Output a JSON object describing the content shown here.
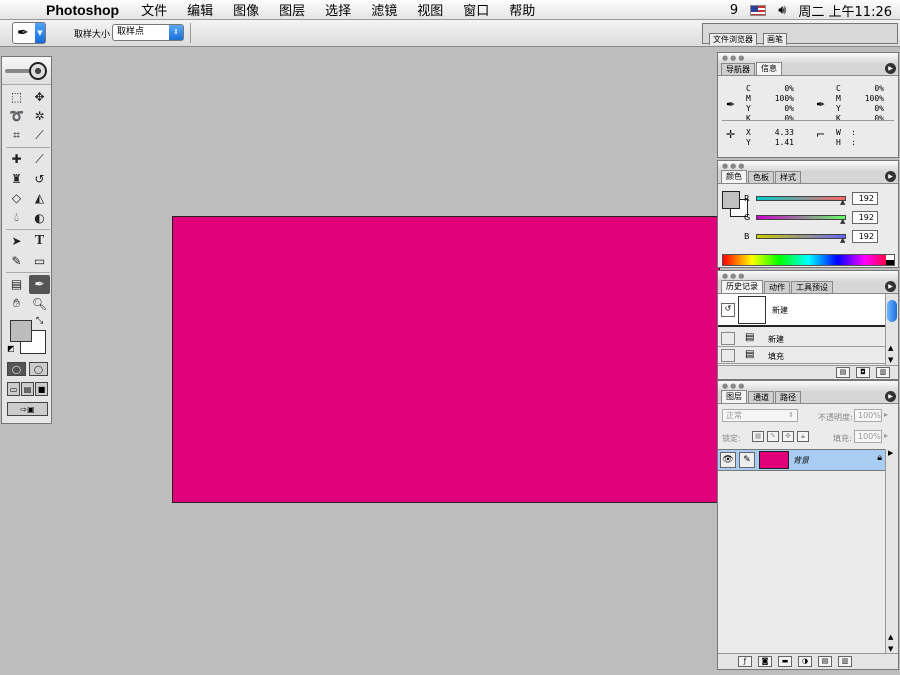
{
  "menubar": {
    "app": "Photoshop",
    "items": [
      "文件",
      "编辑",
      "图像",
      "图层",
      "选择",
      "滤镜",
      "视图",
      "窗口",
      "帮助"
    ],
    "clock": "周二 上午11:26",
    "status_glyph": "9"
  },
  "options": {
    "sample_label": "取样大小",
    "sample_value": "取样点"
  },
  "palette_well": {
    "tabs": [
      "文件浏览器",
      "画笔"
    ]
  },
  "canvas": {
    "fill_color": "#E0007A"
  },
  "info_panel": {
    "tabs": [
      "导航器",
      "信息"
    ],
    "cmyk_labels": [
      "C",
      "M",
      "Y",
      "K"
    ],
    "cmyk_left": [
      "0%",
      "100%",
      "0%",
      "0%"
    ],
    "cmyk_right": [
      "0%",
      "100%",
      "0%",
      "0%"
    ],
    "x_label": "X",
    "x_value": "4.33",
    "y_label": "Y",
    "y_value": "1.41",
    "w_label": "W",
    "h_label": "H"
  },
  "color_panel": {
    "tabs": [
      "颜色",
      "色板",
      "样式"
    ],
    "channels": [
      {
        "label": "R",
        "value": "192"
      },
      {
        "label": "G",
        "value": "192"
      },
      {
        "label": "B",
        "value": "192"
      }
    ],
    "fg_color": "#C0C0C0"
  },
  "history_panel": {
    "tabs": [
      "历史记录",
      "动作",
      "工具预设"
    ],
    "snapshot_label": "新建",
    "states": [
      "新建",
      "填充"
    ]
  },
  "layers_panel": {
    "tabs": [
      "图层",
      "通道",
      "路径"
    ],
    "blend_mode": "正常",
    "opacity_label": "不透明度:",
    "opacity_value": "100%",
    "lock_label": "锁定:",
    "fill_label": "填充:",
    "fill_value": "100%",
    "layer_name": "背景"
  }
}
